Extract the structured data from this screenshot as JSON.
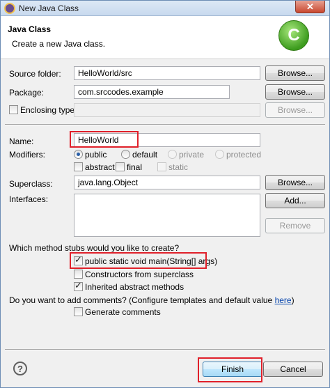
{
  "window": {
    "title": "New Java Class",
    "close_glyph": "✕"
  },
  "header": {
    "title": "Java Class",
    "description": "Create a new Java class.",
    "badge": "C"
  },
  "source_folder": {
    "label": "Source folder:",
    "value": "HelloWorld/src",
    "browse": "Browse..."
  },
  "package": {
    "label": "Package:",
    "value": "com.srccodes.example",
    "browse": "Browse..."
  },
  "enclosing": {
    "label": "Enclosing type:",
    "value": "",
    "browse": "Browse..."
  },
  "name": {
    "label": "Name:",
    "value": "HelloWorld"
  },
  "modifiers": {
    "label": "Modifiers:",
    "visibility": [
      "public",
      "default",
      "private",
      "protected"
    ],
    "selected": "public",
    "flags": [
      "abstract",
      "final",
      "static"
    ]
  },
  "superclass": {
    "label": "Superclass:",
    "value": "java.lang.Object",
    "browse": "Browse..."
  },
  "interfaces": {
    "label": "Interfaces:",
    "add": "Add...",
    "remove": "Remove"
  },
  "stubs": {
    "question": "Which method stubs would you like to create?",
    "options": [
      "public static void main(String[] args)",
      "Constructors from superclass",
      "Inherited abstract methods"
    ],
    "checked": [
      true,
      false,
      true
    ]
  },
  "comments": {
    "question_prefix": "Do you want to add comments? (Configure templates and default value ",
    "link": "here",
    "question_suffix": ")",
    "option": "Generate comments",
    "checked": false
  },
  "footer": {
    "help": "?",
    "finish": "Finish",
    "cancel": "Cancel"
  }
}
